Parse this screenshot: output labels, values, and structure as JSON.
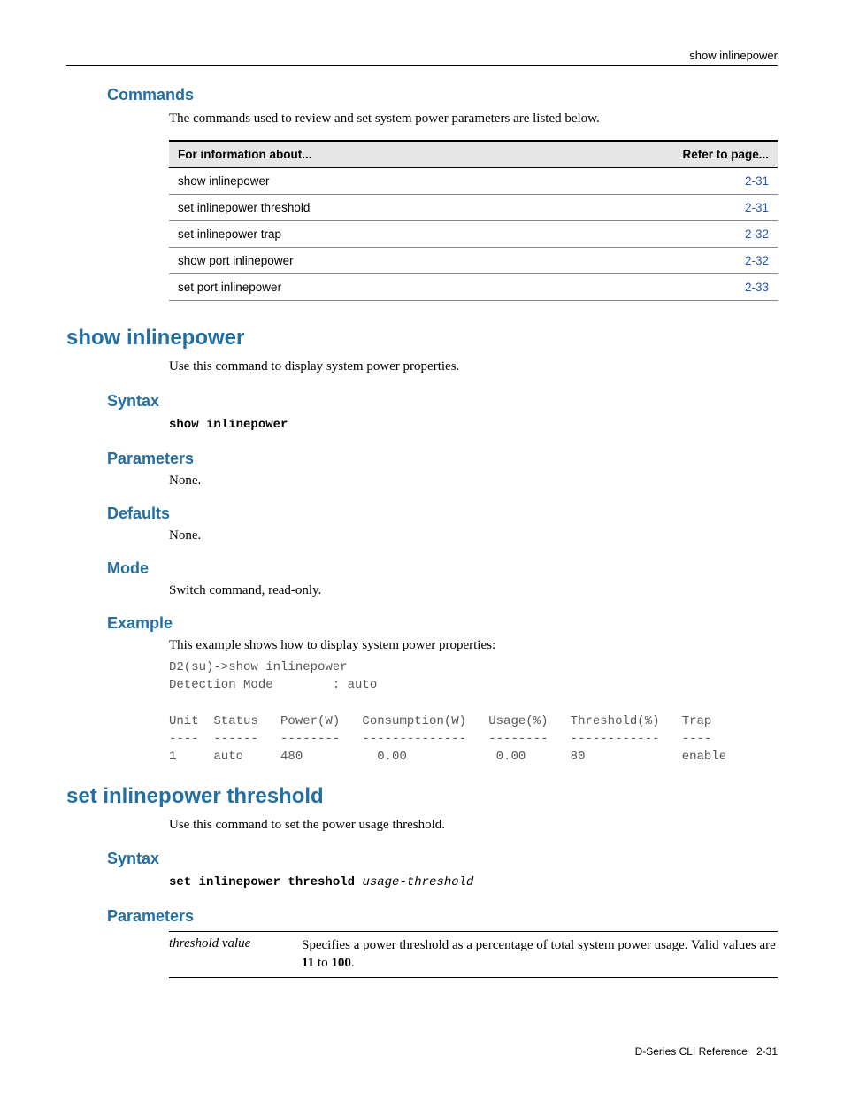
{
  "header": {
    "right": "show inlinepower"
  },
  "commands": {
    "heading": "Commands",
    "intro": "The commands used to review and set system power parameters are listed below.",
    "th1": "For information about...",
    "th2": "Refer to page...",
    "rows": [
      {
        "name": "show inlinepower",
        "page": "2-31"
      },
      {
        "name": "set inlinepower threshold",
        "page": "2-31"
      },
      {
        "name": "set inlinepower trap",
        "page": "2-32"
      },
      {
        "name": "show port inlinepower",
        "page": "2-32"
      },
      {
        "name": "set port inlinepower",
        "page": "2-33"
      }
    ]
  },
  "show": {
    "heading": "show inlinepower",
    "intro": "Use this command to display system power properties.",
    "syntax_h": "Syntax",
    "syntax": "show inlinepower",
    "params_h": "Parameters",
    "params_v": "None.",
    "defaults_h": "Defaults",
    "defaults_v": "None.",
    "mode_h": "Mode",
    "mode_v": "Switch command, read-only.",
    "example_h": "Example",
    "example_intro": "This example shows how to display system power properties:",
    "example_out": "D2(su)->show inlinepower\nDetection Mode        : auto\n\nUnit  Status   Power(W)   Consumption(W)   Usage(%)   Threshold(%)   Trap\n----  ------   --------   --------------   --------   ------------   ----\n1     auto     480          0.00            0.00      80             enable"
  },
  "set": {
    "heading": "set inlinepower threshold",
    "intro": "Use this command to set the power usage threshold.",
    "syntax_h": "Syntax",
    "syntax_b": "set inlinepower threshold ",
    "syntax_i": "usage-threshold",
    "params_h": "Parameters",
    "param_name": "threshold value",
    "param_desc_a": "Specifies a power threshold as a percentage of total system power usage. Valid values are ",
    "param_desc_b": "11",
    "param_desc_c": " to ",
    "param_desc_d": "100",
    "param_desc_e": "."
  },
  "chart_data": {
    "type": "table",
    "title": "show inlinepower output",
    "detection_mode": "auto",
    "columns": [
      "Unit",
      "Status",
      "Power(W)",
      "Consumption(W)",
      "Usage(%)",
      "Threshold(%)",
      "Trap"
    ],
    "rows": [
      {
        "Unit": 1,
        "Status": "auto",
        "Power(W)": 480,
        "Consumption(W)": 0.0,
        "Usage(%)": 0.0,
        "Threshold(%)": 80,
        "Trap": "enable"
      }
    ]
  },
  "footer": {
    "left": "D-Series CLI Reference",
    "right": "2-31"
  }
}
